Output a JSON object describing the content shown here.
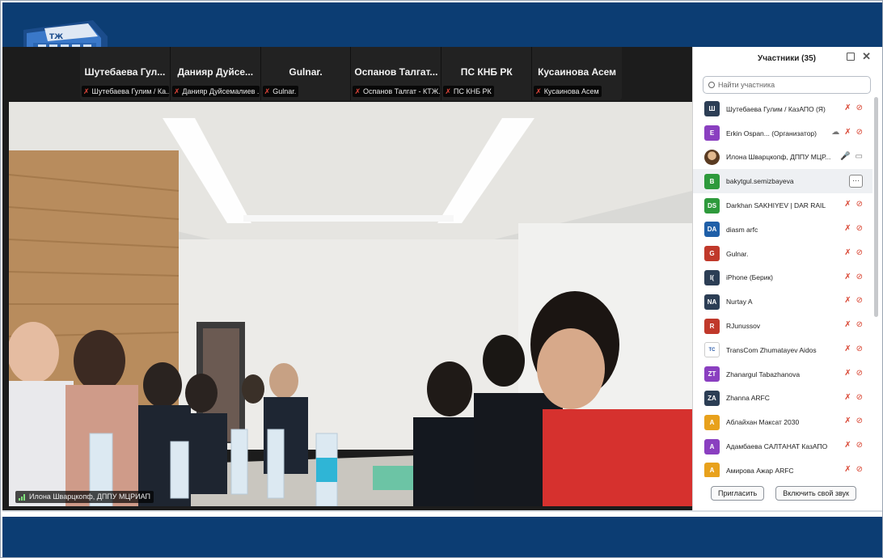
{
  "colors": {
    "band": "#0c3d73",
    "mic_off": "#d8422f"
  },
  "thumbnails": [
    {
      "name": "Шутебаева  Гул...",
      "tag": "Шутебаева Гулим / Ка..."
    },
    {
      "name": "Данияр  Дуйсе...",
      "tag": "Данияр Дуйсемалиев ..."
    },
    {
      "name": "Gulnar.",
      "tag": "Gulnar."
    },
    {
      "name": "Оспанов  Талгат...",
      "tag": "Оспанов Талгат - КТЖ..."
    },
    {
      "name": "ПС КНБ РК",
      "tag": "ПС КНБ РК"
    },
    {
      "name": "Кусаинова Асем",
      "tag": "Кусаинова Асем"
    }
  ],
  "active_speaker": {
    "label": "Илона Шварцкопф, ДППУ МЦРИАП"
  },
  "panel": {
    "title": "Участники (35)",
    "search_placeholder": "Найти участника",
    "participants": [
      {
        "initials": "Ш",
        "name": "Шутебаева Гулим / КазАПО (Я)",
        "color": "#2c3e55",
        "icons": [
          "mic-off-icon",
          "video-off-icon"
        ]
      },
      {
        "initials": "E",
        "name": "Erkin Ospan...  (Организатор)",
        "color": "#8a3fc0",
        "icons": [
          "cloud-icon",
          "mic-off-icon",
          "video-off-icon"
        ]
      },
      {
        "initials": "",
        "name": "Илона Шварцкопф, ДППУ МЦР...",
        "color": "#b07a3a",
        "photo": true,
        "icons": [
          "mic-icon",
          "video-icon"
        ]
      },
      {
        "initials": "B",
        "name": "bakytgul.semizbayeva",
        "color": "#2e9a3c",
        "highlight": true,
        "icons": [
          "more-icon"
        ]
      },
      {
        "initials": "DS",
        "name": "Darkhan SAKHIYEV | DAR RAIL",
        "color": "#2e9a3c",
        "icons": [
          "mic-off-icon",
          "video-off-icon"
        ]
      },
      {
        "initials": "DA",
        "name": "diasm arfc",
        "color": "#1f5fa8",
        "icons": [
          "mic-off-icon",
          "video-off-icon"
        ]
      },
      {
        "initials": "G",
        "name": "Gulnar.",
        "color": "#c0392b",
        "icons": [
          "mic-off-icon",
          "video-off-icon"
        ]
      },
      {
        "initials": "I(",
        "name": "iPhone (Берик)",
        "color": "#2c3e55",
        "icons": [
          "mic-off-icon",
          "video-off-icon"
        ]
      },
      {
        "initials": "NA",
        "name": "Nurtay A",
        "color": "#2c3e55",
        "icons": [
          "mic-off-icon",
          "video-off-icon"
        ]
      },
      {
        "initials": "R",
        "name": "RJunussov",
        "color": "#c0392b",
        "icons": [
          "mic-off-icon",
          "video-off-icon"
        ]
      },
      {
        "initials": "TC",
        "name": "TransCom Zhumatayev Aidos",
        "color": "#ffffff",
        "logo": true,
        "icons": [
          "mic-off-icon",
          "video-off-icon"
        ]
      },
      {
        "initials": "ZT",
        "name": "Zhanargul Tabazhanova",
        "color": "#8a3fc0",
        "icons": [
          "mic-off-icon",
          "video-off-icon"
        ]
      },
      {
        "initials": "ZA",
        "name": "Zhanna ARFC",
        "color": "#2c3e55",
        "icons": [
          "mic-off-icon",
          "video-off-icon"
        ]
      },
      {
        "initials": "A",
        "name": "Аблайхан Максат 2030",
        "color": "#e8a11c",
        "icons": [
          "mic-off-icon",
          "video-off-icon"
        ]
      },
      {
        "initials": "A",
        "name": "Адамбаева САЛТАНАТ КазАПО",
        "color": "#8a3fc0",
        "icons": [
          "mic-off-icon",
          "video-off-icon"
        ]
      },
      {
        "initials": "A",
        "name": "Амирова Ажар ARFC",
        "color": "#e8a11c",
        "icons": [
          "mic-off-icon",
          "video-off-icon"
        ]
      }
    ],
    "invite_label": "Пригласить",
    "unmute_label": "Включить свой звук"
  }
}
